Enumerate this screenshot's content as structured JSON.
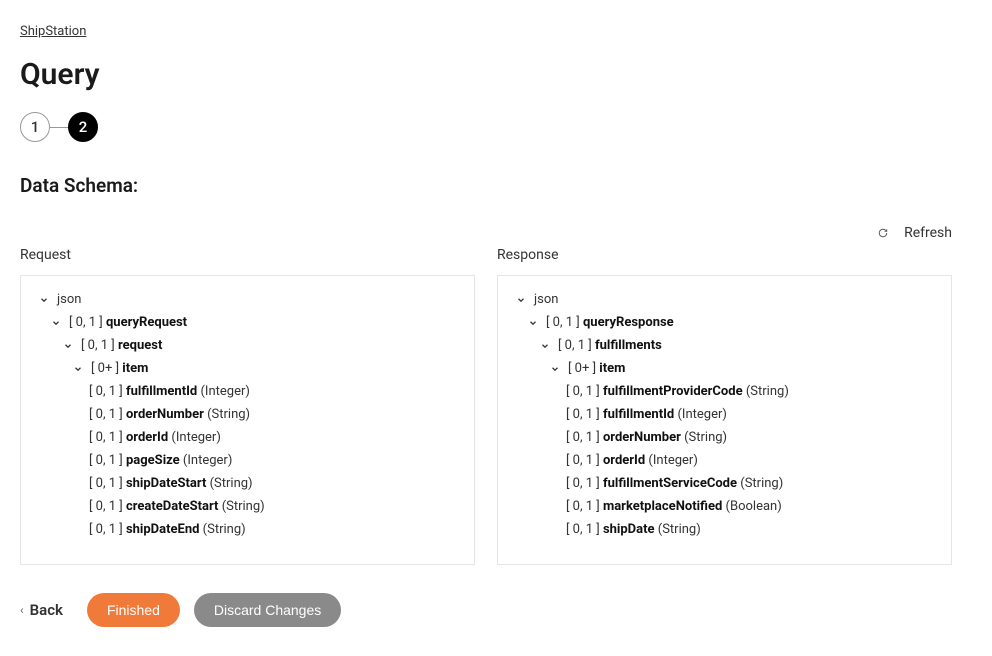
{
  "breadcrumb": "ShipStation",
  "page_title": "Query",
  "stepper": {
    "step1": "1",
    "step2": "2"
  },
  "section_title": "Data Schema:",
  "refresh_label": "Refresh",
  "request_label": "Request",
  "response_label": "Response",
  "root_label": "json",
  "footer": {
    "back": "Back",
    "finished": "Finished",
    "discard": "Discard Changes"
  },
  "request_tree": [
    {
      "depth": 0,
      "chevron": true,
      "cardinality": "",
      "name": "json",
      "type": "",
      "bold": false
    },
    {
      "depth": 1,
      "chevron": true,
      "cardinality": "[ 0, 1 ]",
      "name": "queryRequest",
      "type": "",
      "bold": true
    },
    {
      "depth": 2,
      "chevron": true,
      "cardinality": "[ 0, 1 ]",
      "name": "request",
      "type": "",
      "bold": true
    },
    {
      "depth": 3,
      "chevron": true,
      "cardinality": "[ 0+ ]",
      "name": "item",
      "type": "",
      "bold": true
    },
    {
      "depth": 4,
      "chevron": false,
      "cardinality": "[ 0, 1 ]",
      "name": "fulfillmentId",
      "type": "(Integer)",
      "bold": true
    },
    {
      "depth": 4,
      "chevron": false,
      "cardinality": "[ 0, 1 ]",
      "name": "orderNumber",
      "type": "(String)",
      "bold": true
    },
    {
      "depth": 4,
      "chevron": false,
      "cardinality": "[ 0, 1 ]",
      "name": "orderId",
      "type": "(Integer)",
      "bold": true
    },
    {
      "depth": 4,
      "chevron": false,
      "cardinality": "[ 0, 1 ]",
      "name": "pageSize",
      "type": "(Integer)",
      "bold": true
    },
    {
      "depth": 4,
      "chevron": false,
      "cardinality": "[ 0, 1 ]",
      "name": "shipDateStart",
      "type": "(String)",
      "bold": true
    },
    {
      "depth": 4,
      "chevron": false,
      "cardinality": "[ 0, 1 ]",
      "name": "createDateStart",
      "type": "(String)",
      "bold": true
    },
    {
      "depth": 4,
      "chevron": false,
      "cardinality": "[ 0, 1 ]",
      "name": "shipDateEnd",
      "type": "(String)",
      "bold": true
    }
  ],
  "response_tree": [
    {
      "depth": 0,
      "chevron": true,
      "cardinality": "",
      "name": "json",
      "type": "",
      "bold": false
    },
    {
      "depth": 1,
      "chevron": true,
      "cardinality": "[ 0, 1 ]",
      "name": "queryResponse",
      "type": "",
      "bold": true
    },
    {
      "depth": 2,
      "chevron": true,
      "cardinality": "[ 0, 1 ]",
      "name": "fulfillments",
      "type": "",
      "bold": true
    },
    {
      "depth": 3,
      "chevron": true,
      "cardinality": "[ 0+ ]",
      "name": "item",
      "type": "",
      "bold": true
    },
    {
      "depth": 4,
      "chevron": false,
      "cardinality": "[ 0, 1 ]",
      "name": "fulfillmentProviderCode",
      "type": "(String)",
      "bold": true
    },
    {
      "depth": 4,
      "chevron": false,
      "cardinality": "[ 0, 1 ]",
      "name": "fulfillmentId",
      "type": "(Integer)",
      "bold": true
    },
    {
      "depth": 4,
      "chevron": false,
      "cardinality": "[ 0, 1 ]",
      "name": "orderNumber",
      "type": "(String)",
      "bold": true
    },
    {
      "depth": 4,
      "chevron": false,
      "cardinality": "[ 0, 1 ]",
      "name": "orderId",
      "type": "(Integer)",
      "bold": true
    },
    {
      "depth": 4,
      "chevron": false,
      "cardinality": "[ 0, 1 ]",
      "name": "fulfillmentServiceCode",
      "type": "(String)",
      "bold": true
    },
    {
      "depth": 4,
      "chevron": false,
      "cardinality": "[ 0, 1 ]",
      "name": "marketplaceNotified",
      "type": "(Boolean)",
      "bold": true
    },
    {
      "depth": 4,
      "chevron": false,
      "cardinality": "[ 0, 1 ]",
      "name": "shipDate",
      "type": "(String)",
      "bold": true
    }
  ]
}
